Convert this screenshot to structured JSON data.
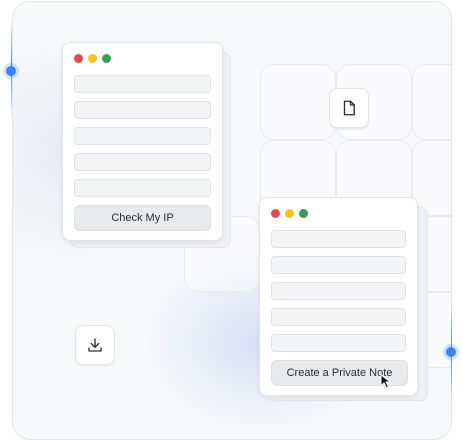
{
  "colors": {
    "accent": "#3b82f6",
    "traffic_red": "#e5484d",
    "traffic_yellow": "#f5c518",
    "traffic_green": "#3a9a5b"
  },
  "window_ip": {
    "button_label": "Check My IP",
    "field_count": 5
  },
  "window_note": {
    "button_label": "Create a Private Note",
    "field_count": 5
  },
  "icons": {
    "document": "document-icon",
    "download": "download-icon",
    "cursor": "cursor-arrow-icon"
  }
}
